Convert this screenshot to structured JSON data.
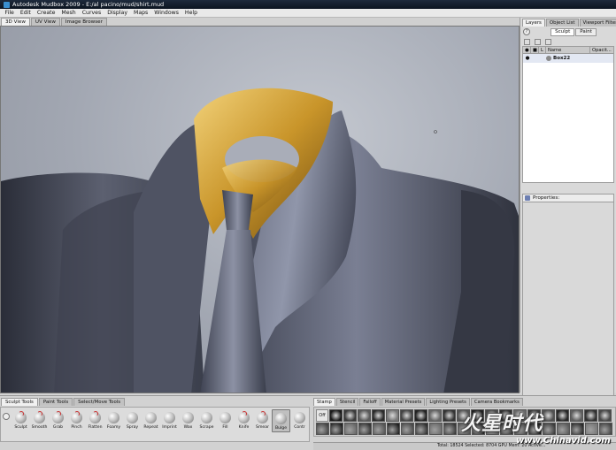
{
  "app": {
    "title": "Autodesk Mudbox 2009 - E:/al pacino/mud/shirt.mud",
    "menu": [
      "File",
      "Edit",
      "Create",
      "Mesh",
      "Curves",
      "Display",
      "Maps",
      "Windows",
      "Help"
    ]
  },
  "view_tabs": [
    "3D View",
    "UV View",
    "Image Browser"
  ],
  "right_panel": {
    "tabs": [
      "Layers",
      "Object List",
      "Viewport Filters"
    ],
    "modes": [
      "Sculpt",
      "Paint"
    ],
    "layer_columns": [
      "",
      "L",
      "Name",
      "Opacity"
    ],
    "layer_columns_display": [
      "L",
      "Name",
      "Opacit..."
    ],
    "layers": [
      {
        "name": "Box22"
      }
    ],
    "properties_title": "Properties:"
  },
  "tool_tabs": [
    "Sculpt Tools",
    "Paint Tools",
    "Select/Move Tools"
  ],
  "tools": [
    {
      "label": "Sculpt"
    },
    {
      "label": "Smooth"
    },
    {
      "label": "Grab"
    },
    {
      "label": "Pinch"
    },
    {
      "label": "Flatten"
    },
    {
      "label": "Foamy"
    },
    {
      "label": "Spray"
    },
    {
      "label": "Repeat"
    },
    {
      "label": "Imprint"
    },
    {
      "label": "Wax"
    },
    {
      "label": "Scrape"
    },
    {
      "label": "Fill"
    },
    {
      "label": "Knife"
    },
    {
      "label": "Smear"
    },
    {
      "label": "Bulge"
    },
    {
      "label": "Contr"
    }
  ],
  "selected_tool": "Bulge",
  "stamp_tabs": [
    "Stamp",
    "Stencil",
    "Falloff",
    "Material Presets",
    "Lighting Presets",
    "Camera Bookmarks"
  ],
  "stamp_off_label": "Off",
  "status": {
    "text": "Total: 18524  Selected: 8704 GPU Mem: 20  Active..."
  },
  "watermark": {
    "text": "火星时代",
    "url": "www.Chinavid.com"
  },
  "colors": {
    "collar": "#c9952a",
    "suit": "#4a4e5e",
    "viewport_bg": "#a2a7b2"
  }
}
